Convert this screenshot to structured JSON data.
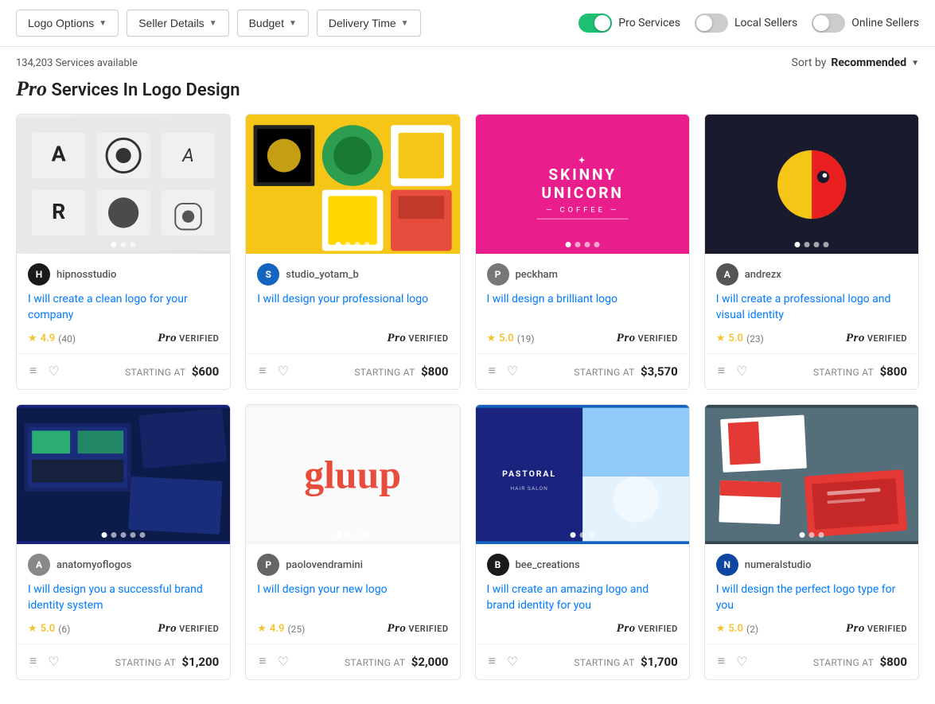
{
  "filters": {
    "logo_options": "Logo Options",
    "seller_details": "Seller Details",
    "budget": "Budget",
    "delivery_time": "Delivery Time"
  },
  "toggles": {
    "pro_services": {
      "label": "Pro Services",
      "on": true
    },
    "local_sellers": {
      "label": "Local Sellers",
      "on": false
    },
    "online_sellers": {
      "label": "Online Sellers",
      "on": false
    }
  },
  "results": {
    "count": "134,203 Services available",
    "sort_label": "Sort by",
    "sort_value": "Recommended"
  },
  "page_title": "Services In Logo Design",
  "cards": [
    {
      "id": 1,
      "seller": "hipnosstudio",
      "avatar_color": "#1a1a1a",
      "avatar_letter": "H",
      "title": "I will create a clean logo for your company",
      "rating": "4.9",
      "reviews": "40",
      "price": "$600",
      "dots": 3,
      "active_dot": 0,
      "bg_class": "img-bg-1"
    },
    {
      "id": 2,
      "seller": "studio_yotam_b",
      "avatar_color": "#1565c0",
      "avatar_letter": "S",
      "title": "I will design your professional logo",
      "rating": null,
      "reviews": null,
      "price": "$800",
      "dots": 4,
      "active_dot": 0,
      "bg_class": "img-bg-2"
    },
    {
      "id": 3,
      "seller": "peckham",
      "avatar_color": "#777",
      "avatar_letter": "P",
      "title": "I will design a brilliant logo",
      "rating": "5.0",
      "reviews": "19",
      "price": "$3,570",
      "dots": 4,
      "active_dot": 0,
      "bg_class": "img-bg-3"
    },
    {
      "id": 4,
      "seller": "andrezx",
      "avatar_color": "#555",
      "avatar_letter": "A",
      "title": "I will create a professional logo and visual identity",
      "rating": "5.0",
      "reviews": "23",
      "price": "$800",
      "dots": 4,
      "active_dot": 0,
      "bg_class": "img-bg-4"
    },
    {
      "id": 5,
      "seller": "anatomyoflogos",
      "avatar_color": "#888",
      "avatar_letter": "A",
      "title": "I will design you a successful brand identity system",
      "rating": "5.0",
      "reviews": "6",
      "price": "$1,200",
      "dots": 5,
      "active_dot": 0,
      "bg_class": "img-bg-5"
    },
    {
      "id": 6,
      "seller": "paolovendramini",
      "avatar_color": "#666",
      "avatar_letter": "P",
      "title": "I will design your new logo",
      "rating": "4.9",
      "reviews": "25",
      "price": "$2,000",
      "dots": 4,
      "active_dot": 0,
      "bg_class": "img-bg-6"
    },
    {
      "id": 7,
      "seller": "bee_creations",
      "avatar_color": "#1a1a1a",
      "avatar_letter": "B",
      "title": "I will create an amazing logo and brand identity for you",
      "rating": null,
      "reviews": null,
      "price": "$1,700",
      "dots": 3,
      "active_dot": 0,
      "bg_class": "img-bg-7"
    },
    {
      "id": 8,
      "seller": "numeralstudio",
      "avatar_color": "#0d47a1",
      "avatar_letter": "N",
      "title": "I will design the perfect logo type for you",
      "rating": "5.0",
      "reviews": "2",
      "price": "$800",
      "dots": 3,
      "active_dot": 0,
      "bg_class": "img-bg-8"
    }
  ]
}
